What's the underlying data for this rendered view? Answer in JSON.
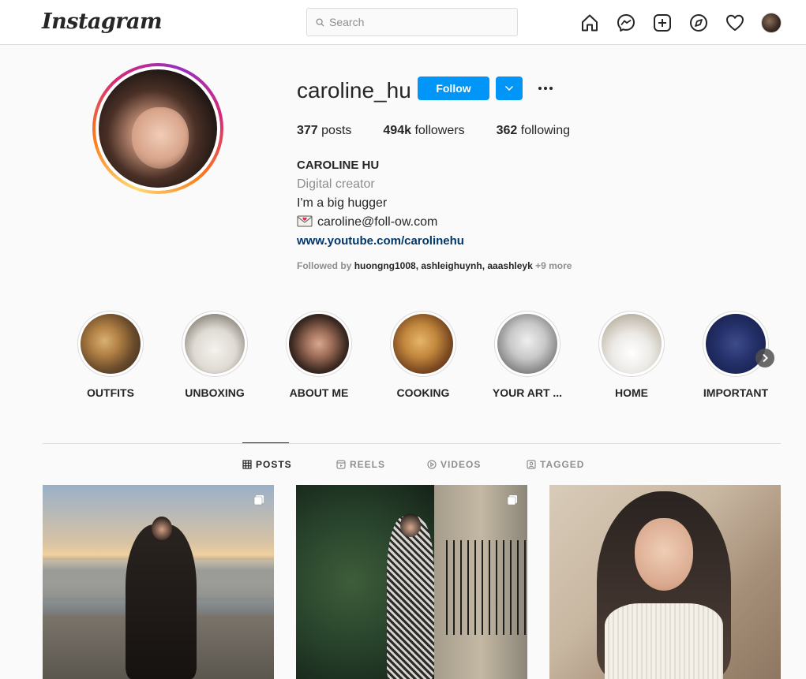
{
  "app": {
    "logo": "Instagram"
  },
  "search": {
    "placeholder": "Search"
  },
  "nav_icons": [
    "home-icon",
    "messenger-icon",
    "new-post-icon",
    "explore-icon",
    "activity-heart-icon",
    "profile-avatar"
  ],
  "profile": {
    "username": "caroline_hu",
    "follow_label": "Follow",
    "stats": {
      "posts_count": "377",
      "posts_label": "posts",
      "followers_count": "494k",
      "followers_label": "followers",
      "following_count": "362",
      "following_label": "following"
    },
    "full_name": "CAROLINE HU",
    "category": "Digital creator",
    "bio_line": "I'm a big hugger",
    "email": "caroline@foll-ow.com",
    "website": "www.youtube.com/carolinehu",
    "followed_by_prefix": "Followed by",
    "followed_by_names": "huongng1008, ashleighuynh, aaashleyk",
    "followed_by_more": "+9 more"
  },
  "highlights": [
    {
      "label": "OUTFITS"
    },
    {
      "label": "UNBOXING"
    },
    {
      "label": "ABOUT ME"
    },
    {
      "label": "COOKING"
    },
    {
      "label": "YOUR ART ..."
    },
    {
      "label": "HOME"
    },
    {
      "label": "IMPORTANT"
    }
  ],
  "tabs": [
    {
      "label": "POSTS",
      "icon": "grid-icon",
      "active": true
    },
    {
      "label": "REELS",
      "icon": "reels-icon",
      "active": false
    },
    {
      "label": "VIDEOS",
      "icon": "video-icon",
      "active": false
    },
    {
      "label": "TAGGED",
      "icon": "tagged-icon",
      "active": false
    }
  ],
  "colors": {
    "accent": "#0095f6",
    "link": "#00376b",
    "muted": "#8e8e8e",
    "text": "#262626"
  }
}
